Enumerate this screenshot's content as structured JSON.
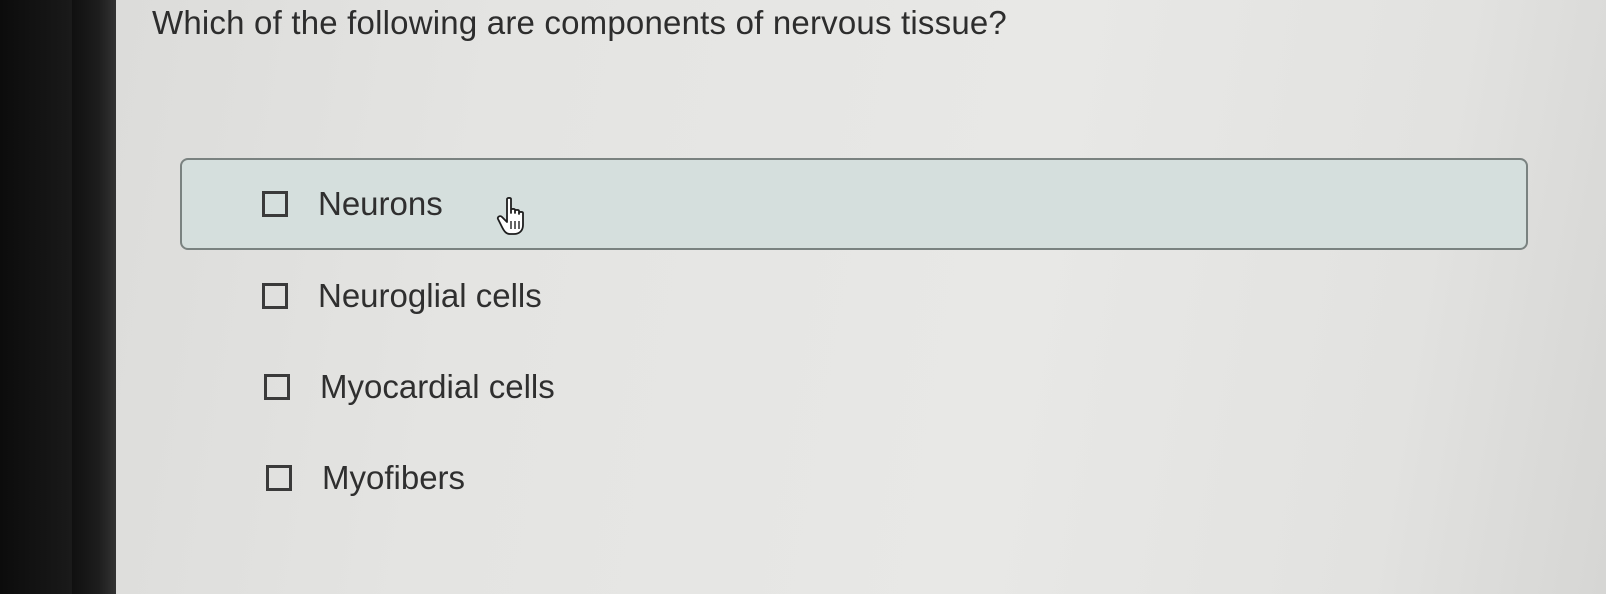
{
  "question": {
    "text": "Which of the following are components of nervous tissue?"
  },
  "options": [
    {
      "label": "Neurons",
      "checked": false,
      "hovered": true
    },
    {
      "label": "Neuroglial cells",
      "checked": false,
      "hovered": false
    },
    {
      "label": "Myocardial cells",
      "checked": false,
      "hovered": false
    },
    {
      "label": "Myofibers",
      "checked": false,
      "hovered": false
    }
  ],
  "colors": {
    "hover_background": "#d5dfdd",
    "hover_border": "#7a8280",
    "text": "#2f2f2f",
    "panel_background": "#e6e6e4"
  },
  "cursor": {
    "icon": "hand-pointer-icon"
  }
}
